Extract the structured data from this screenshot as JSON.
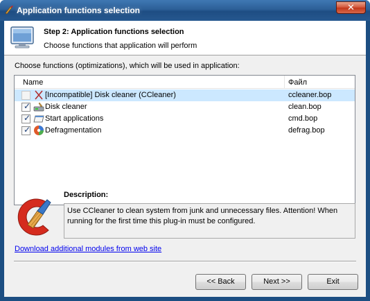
{
  "window": {
    "title": "Application functions selection",
    "close_glyph": "✕"
  },
  "header": {
    "title": "Step 2: Application functions selection",
    "subtitle": "Choose functions that application will perform"
  },
  "panel_label": "Choose functions (optimizations), which will be used in application:",
  "list": {
    "columns": {
      "name": "Name",
      "file": "Файл"
    },
    "rows": [
      {
        "name": "[Incompatible] Disk cleaner (CCleaner)",
        "file": "ccleaner.bop",
        "checked": false,
        "disabled": true,
        "selected": true,
        "icon": "incompatible-x-icon"
      },
      {
        "name": "Disk cleaner",
        "file": "clean.bop",
        "checked": true,
        "disabled": false,
        "selected": false,
        "icon": "disk-cleaner-icon"
      },
      {
        "name": "Start applications",
        "file": "cmd.bop",
        "checked": true,
        "disabled": false,
        "selected": false,
        "icon": "start-applications-icon"
      },
      {
        "name": "Defragmentation",
        "file": "defrag.bop",
        "checked": true,
        "disabled": false,
        "selected": false,
        "icon": "defragmentation-icon"
      }
    ]
  },
  "description": {
    "label": "Description:",
    "text": "Use CCleaner to clean system from junk and unnecessary files. Attention! When running for the first time this plug-in must be configured."
  },
  "download_link": "Download additional modules from web site",
  "buttons": {
    "back": "<< Back",
    "next": "Next >>",
    "exit": "Exit"
  },
  "colors": {
    "selection": "#cce8ff",
    "title_bar": "#2c5f97",
    "link": "#0000ee",
    "close_button": "#c0371b"
  }
}
